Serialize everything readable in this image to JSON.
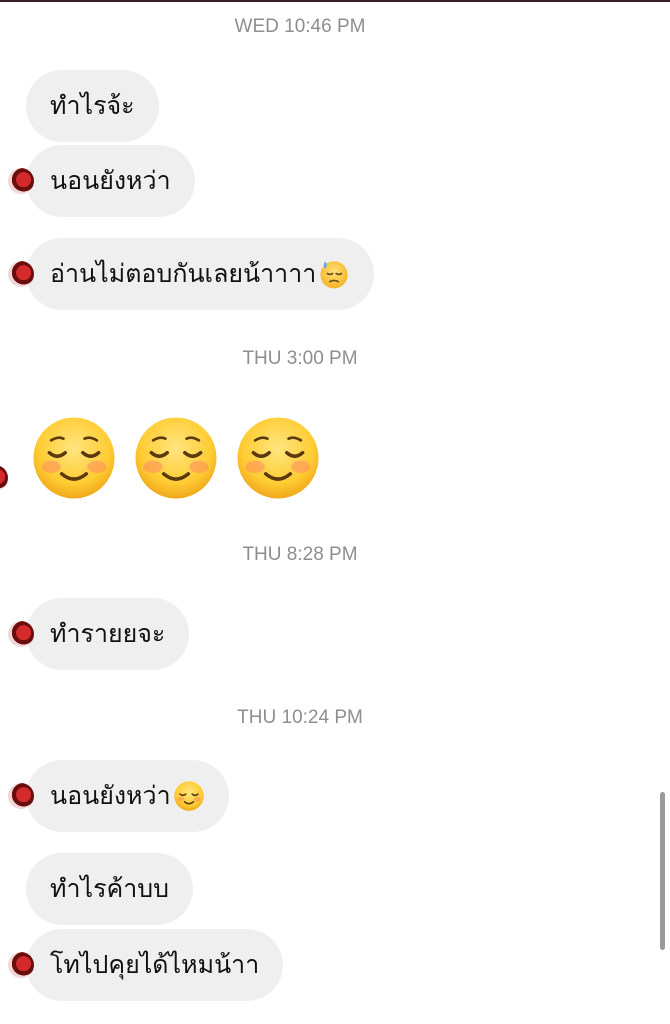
{
  "timestamps": {
    "t1": "WED 10:46 PM",
    "t2": "THU 3:00 PM",
    "t3": "THU 8:28 PM",
    "t4": "THU 10:24 PM"
  },
  "messages": [
    {
      "text": "ทำไรจ้ะ"
    },
    {
      "text": "นอนยังหว่า"
    },
    {
      "text": "อ่านไม่ตอบกันเลยน้าาาา",
      "emoji": "sad-sweat-face-icon"
    },
    {
      "emoji": "smiling-face-icon",
      "count": 3
    },
    {
      "text": "ทำรายยจะ"
    },
    {
      "text": "นอนยังหว่า",
      "emoji": "smiling-face-icon"
    },
    {
      "text": "ทำไรค้าบบ"
    },
    {
      "text": "โทไปคุยได้ไหมน้าา"
    }
  ],
  "colors": {
    "bubble": "#efefef",
    "timestamp": "#8e8e8e",
    "emoji_face": "#ffd040"
  }
}
